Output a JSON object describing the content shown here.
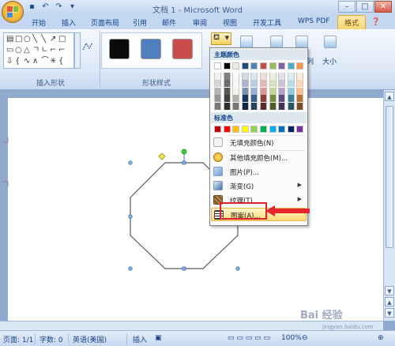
{
  "window": {
    "title": "文档 1 - Microsoft Word",
    "controls": [
      "minimize-icon",
      "maximize-icon",
      "close-icon"
    ]
  },
  "quick_access": [
    "save-icon",
    "undo-icon",
    "redo-icon",
    "customize-icon"
  ],
  "tabs": [
    {
      "label": "开始"
    },
    {
      "label": "插入"
    },
    {
      "label": "页面布局"
    },
    {
      "label": "引用"
    },
    {
      "label": "邮件"
    },
    {
      "label": "审阅"
    },
    {
      "label": "视图"
    },
    {
      "label": "开发工具"
    },
    {
      "label": "WPS PDF"
    },
    {
      "label": "格式"
    }
  ],
  "ribbon": {
    "insert_shapes_label": "插入形状",
    "shape_styles_label": "形状样式",
    "style_colors": [
      "#0b0b0b",
      "#4f7fbf",
      "#c84d4b"
    ],
    "arrange_char": "列",
    "size_label": "大小"
  },
  "fill_menu": {
    "theme_header": "主题颜色",
    "theme_colors": [
      "#ffffff",
      "#000000",
      "#eeece1",
      "#1f497d",
      "#4f81bd",
      "#c0504d",
      "#9bbb59",
      "#8064a2",
      "#4bacc6",
      "#f79646"
    ],
    "standard_header": "标准色",
    "standard_colors": [
      "#c00000",
      "#ff0000",
      "#ffc000",
      "#ffff00",
      "#92d050",
      "#00b050",
      "#00b0f0",
      "#0070c0",
      "#002060",
      "#7030a0"
    ],
    "items": [
      {
        "label": "无填充颜色(N)",
        "icon": "no-fill-icon"
      },
      {
        "label": "其他填充颜色(M)...",
        "icon": "palette-icon"
      },
      {
        "label": "图片(P)...",
        "icon": "picture-icon"
      },
      {
        "label": "渐变(G)",
        "icon": "gradient-icon",
        "submenu": true
      },
      {
        "label": "纹理(T)",
        "icon": "texture-icon",
        "submenu": true
      },
      {
        "label": "图案(A)...",
        "icon": "pattern-icon",
        "highlighted": true
      }
    ]
  },
  "status": {
    "page": "页面: 1/1",
    "words": "字数: 0",
    "language": "英语(美国)",
    "mode": "插入",
    "zoom": "100%"
  },
  "watermark": {
    "brand": "Bai 经验",
    "url": "jingyan.baidu.com"
  }
}
